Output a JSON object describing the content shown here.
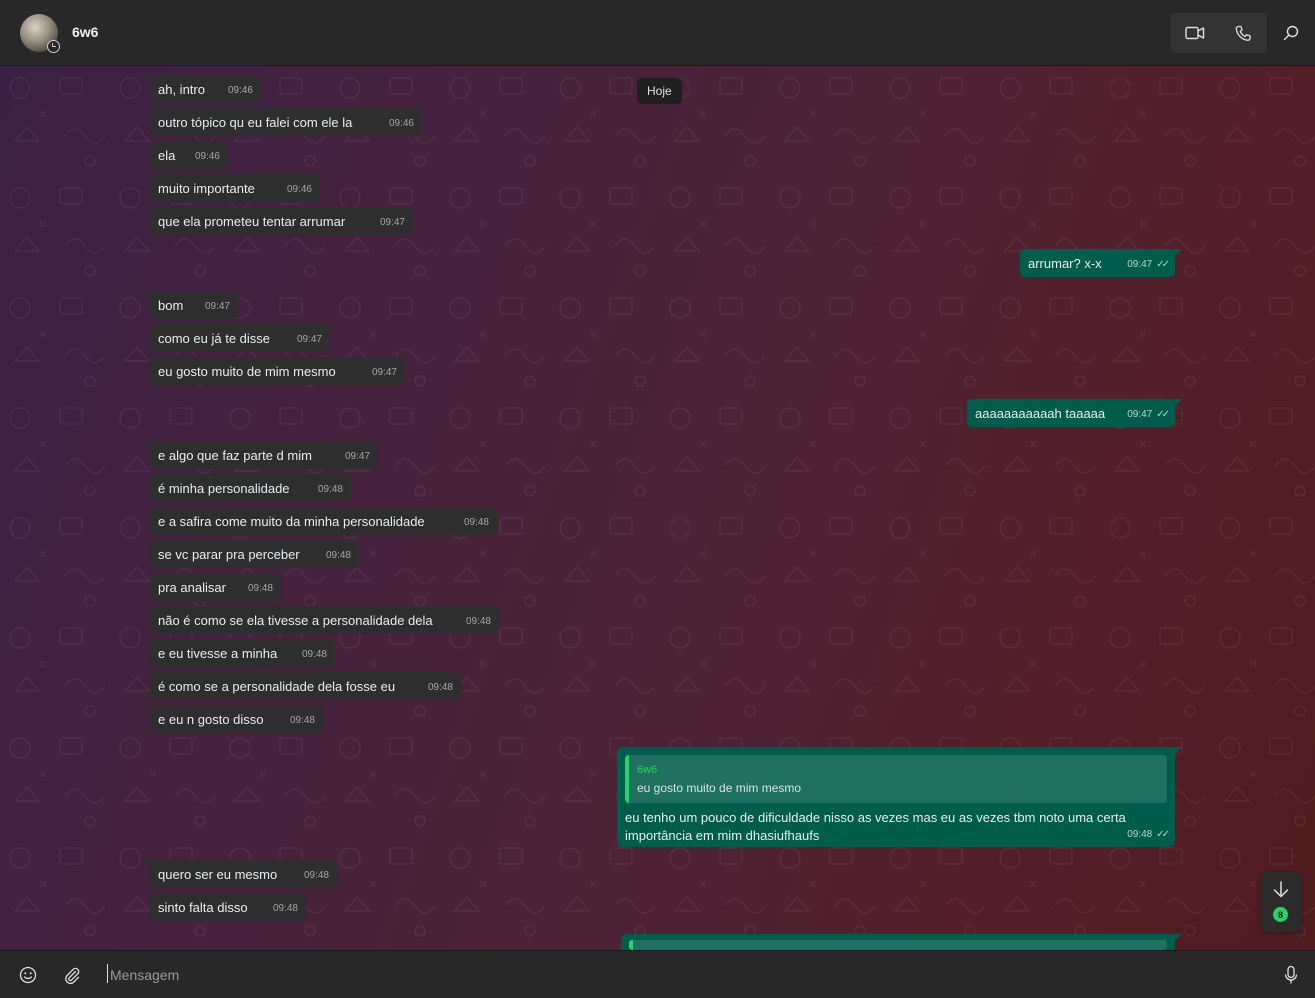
{
  "header": {
    "contact_name": "6w6",
    "avatar_icon": "contact-avatar",
    "status_icon": "status-ring-icon",
    "video_icon": "video-call-icon",
    "voice_icon": "voice-call-icon",
    "search_icon": "search-icon"
  },
  "chat": {
    "date_chip": "Hoje",
    "messages": [
      {
        "dir": "in",
        "text": "ah, intro",
        "time": "09:46"
      },
      {
        "dir": "in",
        "text": "outro tópico qu eu falei com ele la",
        "time": "09:46"
      },
      {
        "dir": "in",
        "text": "ela",
        "time": "09:46"
      },
      {
        "dir": "in",
        "text": "muito importante",
        "time": "09:46"
      },
      {
        "dir": "in",
        "text": "que ela prometeu tentar arrumar",
        "time": "09:47"
      },
      {
        "dir": "out",
        "text": "arrumar? x-x",
        "time": "09:47"
      },
      {
        "dir": "in",
        "text": "bom",
        "time": "09:47"
      },
      {
        "dir": "in",
        "text": "como eu já te disse",
        "time": "09:47"
      },
      {
        "dir": "in",
        "text": "eu gosto muito de mim mesmo",
        "time": "09:47"
      },
      {
        "dir": "out",
        "text": "aaaaaaaaaaah taaaaa",
        "time": "09:47"
      },
      {
        "dir": "in",
        "text": "e algo que faz parte d mim",
        "time": "09:47"
      },
      {
        "dir": "in",
        "text": "é minha personalidade",
        "time": "09:48"
      },
      {
        "dir": "in",
        "text": "e a safira come muito da minha personalidade",
        "time": "09:48"
      },
      {
        "dir": "in",
        "text": "se vc parar pra perceber",
        "time": "09:48"
      },
      {
        "dir": "in",
        "text": "pra analisar",
        "time": "09:48"
      },
      {
        "dir": "in",
        "text": "não é como se ela tivesse a personalidade dela",
        "time": "09:48"
      },
      {
        "dir": "in",
        "text": "e eu tivesse a minha",
        "time": "09:48"
      },
      {
        "dir": "in",
        "text": "é como se a personalidade dela fosse eu",
        "time": "09:48"
      },
      {
        "dir": "in",
        "text": "e eu n gosto disso",
        "time": "09:48"
      },
      {
        "dir": "out",
        "quote_name": "6w6",
        "quote_text": "eu gosto muito de mim mesmo",
        "text": "eu tenho um pouco de dificuldade nisso as vezes mas eu as vezes tbm noto uma certa importância em mim dhasiufhaufs",
        "time": "09:48"
      },
      {
        "dir": "in",
        "text": "quero ser eu mesmo",
        "time": "09:48"
      },
      {
        "dir": "in",
        "text": "sinto falta disso",
        "time": "09:48"
      }
    ],
    "scroll_down": {
      "icon": "arrow-down-icon",
      "unread_count": "8"
    }
  },
  "composer": {
    "placeholder": "Mensagem",
    "emoji_icon": "emoji-icon",
    "attach_icon": "attach-icon",
    "mic_icon": "microphone-icon"
  },
  "colors": {
    "incoming_bubble": "#2e2e2e",
    "outgoing_bubble": "#005c4b",
    "accent": "#25d366",
    "header_bg": "#282828"
  }
}
